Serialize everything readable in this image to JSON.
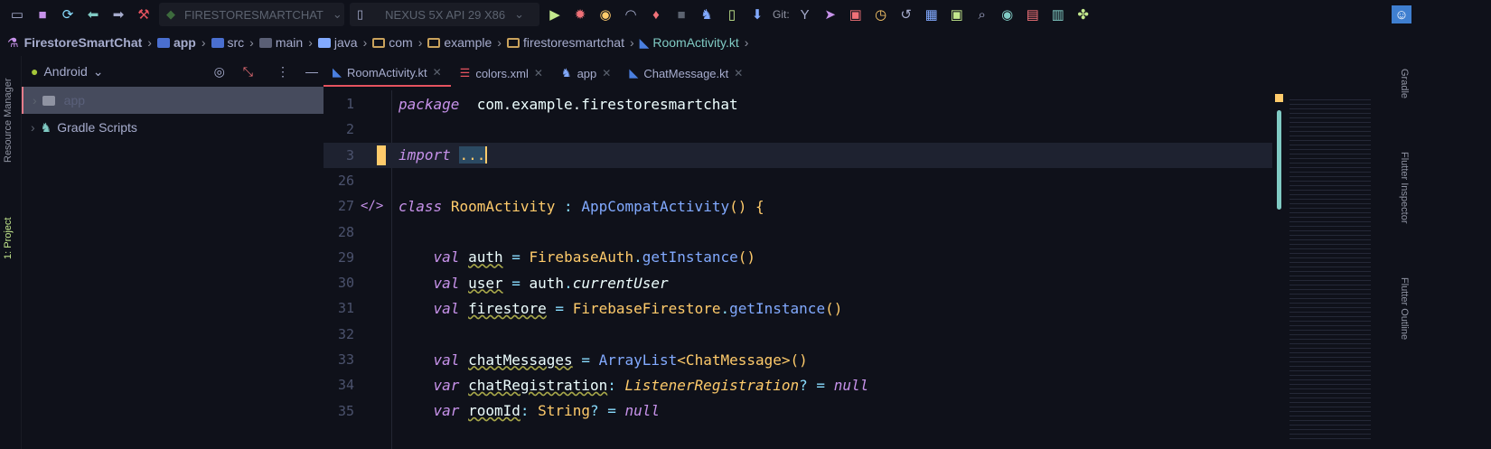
{
  "toolbar": {
    "run_config": "FIRESTORESMARTCHAT",
    "device": "NEXUS 5X API 29 X86",
    "git_label": "Git:"
  },
  "breadcrumb": [
    "FirestoreSmartChat",
    "app",
    "src",
    "main",
    "java",
    "com",
    "example",
    "firestoresmartchat",
    "RoomActivity.kt"
  ],
  "project": {
    "view": "Android",
    "items": [
      "app",
      "Gradle Scripts"
    ]
  },
  "side_left": [
    "Resource Manager",
    "1: Project"
  ],
  "side_right": [
    "Gradle",
    "Flutter Inspector",
    "Flutter Outline"
  ],
  "tabs": [
    "RoomActivity.kt",
    "colors.xml",
    "app",
    "ChatMessage.kt"
  ],
  "colors": {
    "bg": "#0f111a",
    "keyword": "#c792ea",
    "class": "#ffcb6b",
    "function": "#82aaff",
    "accent": "#e5535f"
  },
  "code": [
    {
      "n": "1",
      "t": [
        [
          "kw",
          "package"
        ],
        [
          "",
          "  com.example.firestoresmartchat"
        ]
      ]
    },
    {
      "n": "2",
      "t": []
    },
    {
      "n": "3",
      "t": [
        [
          "kw",
          "import"
        ],
        [
          "",
          " "
        ],
        [
          "cls",
          "..."
        ]
      ]
    },
    {
      "n": "26",
      "t": []
    },
    {
      "n": "27",
      "t": [
        [
          "kw",
          "class"
        ],
        [
          "",
          " "
        ],
        [
          "cls",
          "RoomActivity"
        ],
        [
          "",
          " "
        ],
        [
          "op",
          ":"
        ],
        [
          "",
          " "
        ],
        [
          "fn",
          "AppCompatActivity"
        ],
        [
          "cls",
          "()"
        ],
        [
          "",
          " "
        ],
        [
          "cls",
          "{"
        ]
      ]
    },
    {
      "n": "28",
      "t": []
    },
    {
      "n": "29",
      "t": [
        [
          "",
          "    "
        ],
        [
          "kw",
          "val"
        ],
        [
          "",
          " "
        ],
        [
          "sq",
          "auth"
        ],
        [
          "",
          " "
        ],
        [
          "op",
          "="
        ],
        [
          "",
          " "
        ],
        [
          "cls",
          "FirebaseAuth"
        ],
        [
          "op",
          "."
        ],
        [
          "fn",
          "getInstance"
        ],
        [
          "cls",
          "()"
        ]
      ]
    },
    {
      "n": "30",
      "t": [
        [
          "",
          "    "
        ],
        [
          "kw",
          "val"
        ],
        [
          "",
          " "
        ],
        [
          "sq",
          "user"
        ],
        [
          "",
          " "
        ],
        [
          "op",
          "="
        ],
        [
          "",
          " auth"
        ],
        [
          "op",
          "."
        ],
        [
          "it",
          "currentUser"
        ]
      ]
    },
    {
      "n": "31",
      "t": [
        [
          "",
          "    "
        ],
        [
          "kw",
          "val"
        ],
        [
          "",
          " "
        ],
        [
          "sq",
          "firestore"
        ],
        [
          "",
          " "
        ],
        [
          "op",
          "="
        ],
        [
          "",
          " "
        ],
        [
          "cls",
          "FirebaseFirestore"
        ],
        [
          "op",
          "."
        ],
        [
          "fn",
          "getInstance"
        ],
        [
          "cls",
          "()"
        ]
      ]
    },
    {
      "n": "32",
      "t": []
    },
    {
      "n": "33",
      "t": [
        [
          "",
          "    "
        ],
        [
          "kw",
          "val"
        ],
        [
          "",
          " "
        ],
        [
          "sq",
          "chatMessages"
        ],
        [
          "",
          " "
        ],
        [
          "op",
          "="
        ],
        [
          "",
          " "
        ],
        [
          "fn",
          "ArrayList"
        ],
        [
          "cls",
          "<ChatMessage>()"
        ]
      ]
    },
    {
      "n": "34",
      "t": [
        [
          "",
          "    "
        ],
        [
          "kw",
          "var"
        ],
        [
          "",
          " "
        ],
        [
          "sq",
          "chatRegistration"
        ],
        [
          "op",
          ":"
        ],
        [
          "",
          " "
        ],
        [
          "cls it",
          "ListenerRegistration"
        ],
        [
          "op",
          "?"
        ],
        [
          "",
          " "
        ],
        [
          "op",
          "="
        ],
        [
          "",
          " "
        ],
        [
          "nul",
          "null"
        ]
      ]
    },
    {
      "n": "35",
      "t": [
        [
          "",
          "    "
        ],
        [
          "kw",
          "var"
        ],
        [
          "",
          " "
        ],
        [
          "sq",
          "roomId"
        ],
        [
          "op",
          ":"
        ],
        [
          "",
          " "
        ],
        [
          "cls",
          "String"
        ],
        [
          "op",
          "?"
        ],
        [
          "",
          " "
        ],
        [
          "op",
          "="
        ],
        [
          "",
          " "
        ],
        [
          "nul",
          "null"
        ]
      ]
    }
  ]
}
